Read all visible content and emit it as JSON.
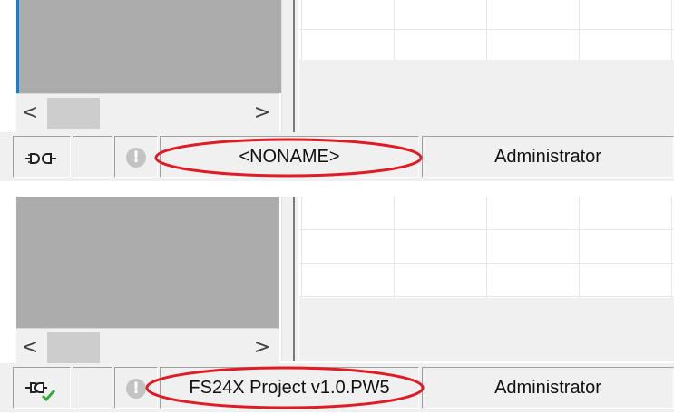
{
  "panels": [
    {
      "status": {
        "connection_icon": "connection-disconnected-icon",
        "warning_icon": "exclamation-circle-icon",
        "project_name": "<NONAME>",
        "user": "Administrator"
      },
      "scrollbar": {
        "left_arrow": "<",
        "right_arrow": ">"
      }
    },
    {
      "status": {
        "connection_icon": "connection-connected-check-icon",
        "warning_icon": "exclamation-circle-icon",
        "project_name": "FS24X Project v1.0.PW5",
        "user": "Administrator"
      },
      "scrollbar": {
        "left_arrow": "<",
        "right_arrow": ">"
      }
    }
  ],
  "colors": {
    "highlight_oval": "#e01b24",
    "splitter_accent": "#1e7fbf",
    "check_green": "#3aa83a"
  },
  "glyphs": {
    "warning": "!"
  }
}
